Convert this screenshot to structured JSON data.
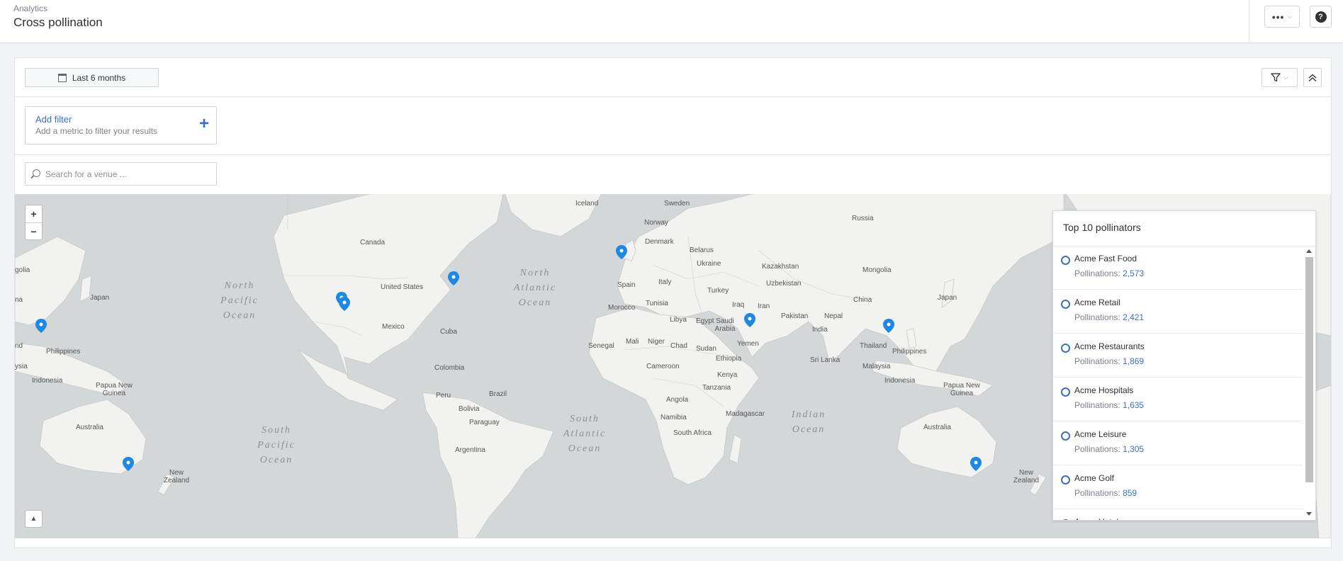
{
  "header": {
    "breadcrumb": "Analytics",
    "title": "Cross pollination",
    "more_icon": "•••",
    "help_icon": "?"
  },
  "toolbar": {
    "date_range": "Last 6 months"
  },
  "filter": {
    "title": "Add filter",
    "subtitle": "Add a metric to filter your results",
    "plus": "+"
  },
  "search": {
    "placeholder": "Search for a venue ..."
  },
  "map": {
    "zoom_in": "+",
    "zoom_out": "−",
    "labels": {
      "iceland": "Iceland",
      "sweden": "Sweden",
      "norway": "Norway",
      "russia": "Russia",
      "canada": "Canada",
      "denmark": "Denmark",
      "belarus": "Belarus",
      "ukraine": "Ukraine",
      "kazakhstan": "Kazakhstan",
      "mongolia": "Mongolia",
      "us": "United States",
      "spain": "Spain",
      "italy": "Italy",
      "turkey": "Turkey",
      "japan_w": "Japan",
      "japan_e": "Japan",
      "china": "China",
      "iraq": "Iraq",
      "iran": "Iran",
      "uzbekistan": "Uzbekistan",
      "morocco": "Morocco",
      "tunisia": "Tunisia",
      "libya": "Libya",
      "egypt": "Egypt",
      "saudi": "Saudi\nArabia",
      "pakistan": "Pakistan",
      "nepal": "Nepal",
      "india": "India",
      "mexico": "Mexico",
      "cuba": "Cuba",
      "senegal": "Senegal",
      "mali": "Mali",
      "niger": "Niger",
      "chad": "Chad",
      "sudan": "Sudan",
      "yemen": "Yemen",
      "ethiopia": "Ethiopia",
      "thailand": "Thailand",
      "philippines_w": "Philippines",
      "philippines_e": "Philippines",
      "srilanka": "Sri Lanka",
      "cameroon": "Cameroon",
      "colombia": "Colombia",
      "kenya": "Kenya",
      "malaysia": "Malaysia",
      "indonesia_w": "Indonesia",
      "indonesia_e": "Indonesia",
      "png_w": "Papua New\nGuinea",
      "png_e": "Papua New\nGuinea",
      "peru": "Peru",
      "brazil": "Brazil",
      "tanzania": "Tanzania",
      "bolivia": "Bolivia",
      "angola": "Angola",
      "madagascar": "Madagascar",
      "namibia": "Namibia",
      "paraguay": "Paraguay",
      "southafrica": "South Africa",
      "australia_w": "Australia",
      "australia_e": "Australia",
      "argentina": "Argentina",
      "nz_w": "New\nZealand",
      "nz_e": "New\nZealand",
      "n_pacific": "North\nPacific\nOcean",
      "n_atlantic": "North\nAtlantic\nOcean",
      "s_pacific": "South\nPacific\nOcean",
      "s_atlantic": "South\nAtlantic\nOcean",
      "indian": "Indian\nOcean",
      "edge_na": "na",
      "edge_nd": "nd",
      "edge_golia": "golia",
      "edge_ysia": "ysia"
    }
  },
  "pollinators": {
    "title": "Top 10 pollinators",
    "value_label": "Pollinations:",
    "items": [
      {
        "name": "Acme Fast Food",
        "value": "2,573"
      },
      {
        "name": "Acme Retail",
        "value": "2,421"
      },
      {
        "name": "Acme Restaurants",
        "value": "1,869"
      },
      {
        "name": "Acme Hospitals",
        "value": "1,635"
      },
      {
        "name": "Acme Leisure",
        "value": "1,305"
      },
      {
        "name": "Acme Golf",
        "value": "859"
      },
      {
        "name": "Acme Hotels",
        "value": ""
      }
    ]
  },
  "colors": {
    "accent": "#3b6fc4",
    "marker": "#1e88e5",
    "land": "#f2f2f0",
    "water": "#d4d7d8"
  }
}
